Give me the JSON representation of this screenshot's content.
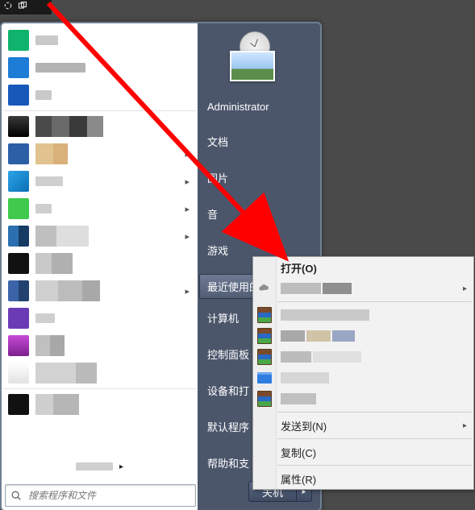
{
  "topbar": {
    "icon1": "loading-icon",
    "icon2": "popout-icon"
  },
  "rightPanel": {
    "username": "Administrator",
    "links": [
      {
        "id": "docs",
        "label": "文档"
      },
      {
        "id": "pictures",
        "label": "图片"
      },
      {
        "id": "music",
        "label": "音"
      },
      {
        "id": "games",
        "label": "游戏"
      },
      {
        "id": "recent",
        "label": "最近使用的项目",
        "highlight": true,
        "arrow": true
      },
      {
        "id": "computer",
        "label": "计算机"
      },
      {
        "id": "control",
        "label": "控制面板"
      },
      {
        "id": "devices",
        "label": "设备和打"
      },
      {
        "id": "defaults",
        "label": "默认程序"
      },
      {
        "id": "help",
        "label": "帮助和支"
      }
    ],
    "shutdown": {
      "label": "关机"
    }
  },
  "search": {
    "placeholder": "搜索程序和文件"
  },
  "contextMenu": {
    "open": "打开(O)",
    "sendTo": "发送到(N)",
    "copy": "复制(C)",
    "properties": "属性(R)"
  },
  "annotation": {
    "arrow_color": "#ff0000"
  }
}
